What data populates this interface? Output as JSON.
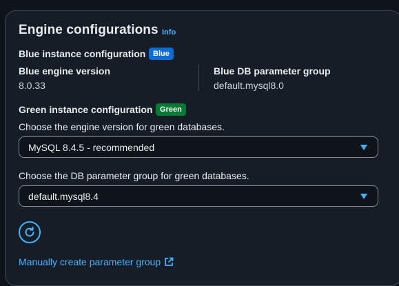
{
  "header": {
    "title": "Engine configurations",
    "info_label": "Info"
  },
  "blue": {
    "section_label": "Blue instance configuration",
    "badge": "Blue",
    "engine_version_label": "Blue engine version",
    "engine_version_value": "8.0.33",
    "param_group_label": "Blue DB parameter group",
    "param_group_value": "default.mysql8.0"
  },
  "green": {
    "section_label": "Green instance configuration",
    "badge": "Green",
    "engine_version_desc": "Choose the engine version for green databases.",
    "engine_version_selected": "MySQL 8.4.5 - recommended",
    "param_group_desc": "Choose the DB parameter group for green databases.",
    "param_group_selected": "default.mysql8.4"
  },
  "actions": {
    "refresh_icon": "refresh-icon",
    "manual_create_link": "Manually create parameter group",
    "external_icon": "external-link-icon"
  },
  "colors": {
    "accent": "#42b4ff",
    "blue_badge": "#0b6bd8",
    "green_badge": "#067a32",
    "background": "#0f141a",
    "card": "#161d26"
  }
}
